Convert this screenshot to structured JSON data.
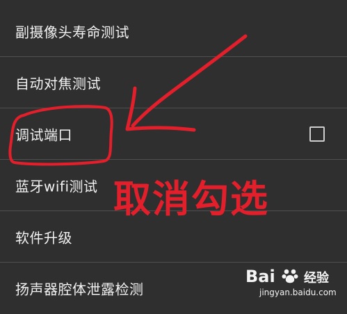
{
  "settings_list": {
    "items": [
      {
        "label": "副摄像头寿命测试"
      },
      {
        "label": "自动对焦测试"
      },
      {
        "label": "调试端口",
        "checked": false
      },
      {
        "label": "蓝牙wifi测试"
      },
      {
        "label": "软件升级"
      },
      {
        "label": "扬声器腔体泄露检测"
      }
    ]
  },
  "annotation": {
    "text": "取消勾选",
    "color": "#e21f2b"
  },
  "watermark": {
    "logo": "Bai",
    "logo_suffix": "经验",
    "url": "jingyan.baidu.com"
  },
  "icons": {
    "checkbox": "checkbox-icon",
    "arrow": "arrow-icon",
    "watermark_logo": "baidu-paw-icon"
  }
}
